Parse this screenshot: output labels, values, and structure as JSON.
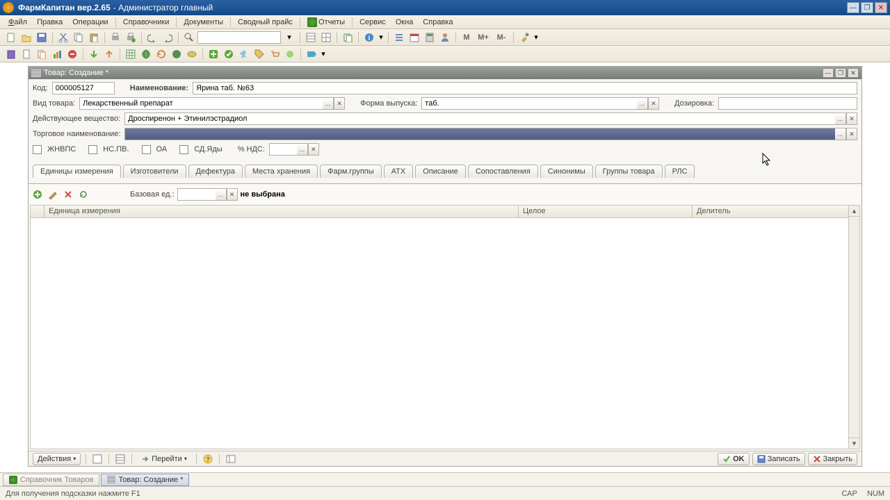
{
  "title": {
    "app": "ФармКапитан вер.2.65",
    "role": "Администратор главный"
  },
  "menu": {
    "file": "Файл",
    "edit": "Правка",
    "ops": "Операции",
    "refs": "Справочники",
    "docs": "Документы",
    "price": "Сводный прайс",
    "reports": "Отчеты",
    "service": "Сервис",
    "windows": "Окна",
    "help": "Справка"
  },
  "inner": {
    "title": "Товар: Создание *"
  },
  "form": {
    "codeLabel": "Код:",
    "code": "000005127",
    "nameLabel": "Наименование:",
    "name": "Ярина таб. №63",
    "typeLabel": "Вид товара:",
    "type": "Лекарственный препарат",
    "releaseLabel": "Форма выпуска:",
    "release": "таб.",
    "dosageLabel": "Дозировка:",
    "substanceLabel": "Действующее вещество:",
    "substance": "Дроспиренон + Этинилэстрадиол",
    "tradeLabel": "Торговое наименование:",
    "chk1": "ЖНВПС",
    "chk2": "НС.ПВ.",
    "chk3": "ОА",
    "chk4": "СД.Яды",
    "ndsLabel": "% НДС:"
  },
  "tabs": {
    "t1": "Единицы измерения",
    "t2": "Изготовители",
    "t3": "Дефектура",
    "t4": "Места хранения",
    "t5": "Фарм.группы",
    "t6": "АТХ",
    "t7": "Описание",
    "t8": "Сопоставления",
    "t9": "Синонимы",
    "t10": "Группы товара",
    "t11": "РЛС"
  },
  "units": {
    "baseLabel": "Базовая ед.:",
    "notSelected": "не выбрана",
    "col1": "Единица измерения",
    "col2": "Целое",
    "col3": "Делитель"
  },
  "bottom": {
    "actions": "Действия",
    "goto": "Перейти",
    "ok": "OK",
    "save": "Записать",
    "close": "Закрыть"
  },
  "taskbar": {
    "t1": "Справочник Товаров",
    "t2": "Товар: Создание *"
  },
  "status": {
    "hint": "Для получения подсказки нажмите F1",
    "cap": "CAP",
    "num": "NUM"
  }
}
